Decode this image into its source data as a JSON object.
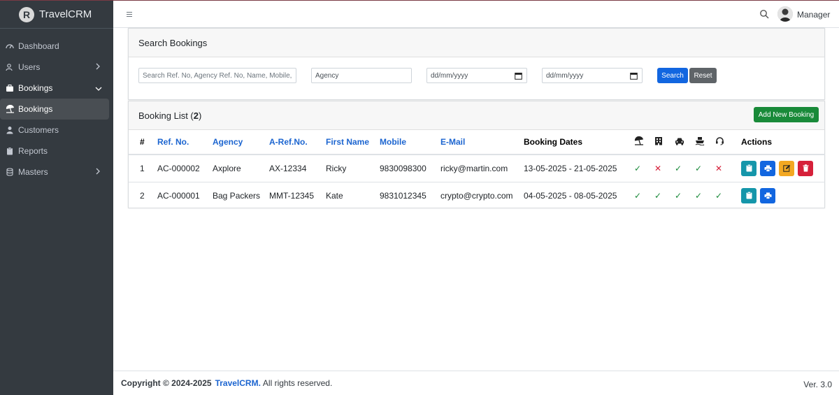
{
  "brand": {
    "name": "TravelCRM",
    "logo_letter": "R"
  },
  "sidebar": {
    "items": [
      {
        "label": "Dashboard",
        "icon": "gauge-icon"
      },
      {
        "label": "Users",
        "icon": "users-icon"
      },
      {
        "label": "Bookings",
        "icon": "briefcase-icon"
      },
      {
        "label": "Bookings",
        "icon": "beach-umbrella-icon"
      },
      {
        "label": "Customers",
        "icon": "user-icon"
      },
      {
        "label": "Reports",
        "icon": "clipboard-icon"
      },
      {
        "label": "Masters",
        "icon": "database-icon"
      }
    ]
  },
  "topbar": {
    "user_name": "Manager"
  },
  "search_card": {
    "title": "Search Bookings",
    "keyword_placeholder": "Search Ref. No, Agency Ref. No, Name, Mobile,",
    "agency_value": "Agency",
    "date_from_placeholder": "dd/mm/yyyy",
    "date_to_placeholder": "dd/mm/yyyy",
    "search_label": "Search",
    "reset_label": "Reset"
  },
  "list_card": {
    "title_prefix": "Booking List (",
    "count": "2",
    "title_suffix": ")",
    "add_label": "Add New Booking"
  },
  "table": {
    "headers": {
      "num": "#",
      "ref": "Ref. No.",
      "agency": "Agency",
      "aref": "A-Ref.No.",
      "first": "First Name",
      "mobile": "Mobile",
      "email": "E-Mail",
      "dates": "Booking Dates",
      "actions": "Actions"
    },
    "service_icons": [
      "holiday-icon",
      "hotel-icon",
      "car-icon",
      "cruise-icon",
      "support-icon"
    ],
    "rows": [
      {
        "num": "1",
        "ref": "AC-000002",
        "agency": "Axplore",
        "aref": "AX-12334",
        "first": "Ricky",
        "mobile": "9830098300",
        "email": "ricky@martin.com",
        "dates": "13-05-2025 - 21-05-2025",
        "services": [
          "✓",
          "✕",
          "✓",
          "✓",
          "✕"
        ]
      },
      {
        "num": "2",
        "ref": "AC-000001",
        "agency": "Bag Packers",
        "aref": "MMT-12345",
        "first": "Kate",
        "mobile": "9831012345",
        "email": "crypto@crypto.com",
        "dates": "04-05-2025 - 08-05-2025",
        "services": [
          "✓",
          "✓",
          "✓",
          "✓",
          "✓"
        ]
      }
    ]
  },
  "footer": {
    "copyright": "Copyright © 2024-2025",
    "brand": "TravelCRM.",
    "rights": "All rights reserved.",
    "version": "Ver. 3.0"
  },
  "colors": {
    "sidebar": "#343a40",
    "link": "#1c65d0",
    "success": "#198a39",
    "danger": "#d6203a",
    "primary": "#1266e0"
  }
}
